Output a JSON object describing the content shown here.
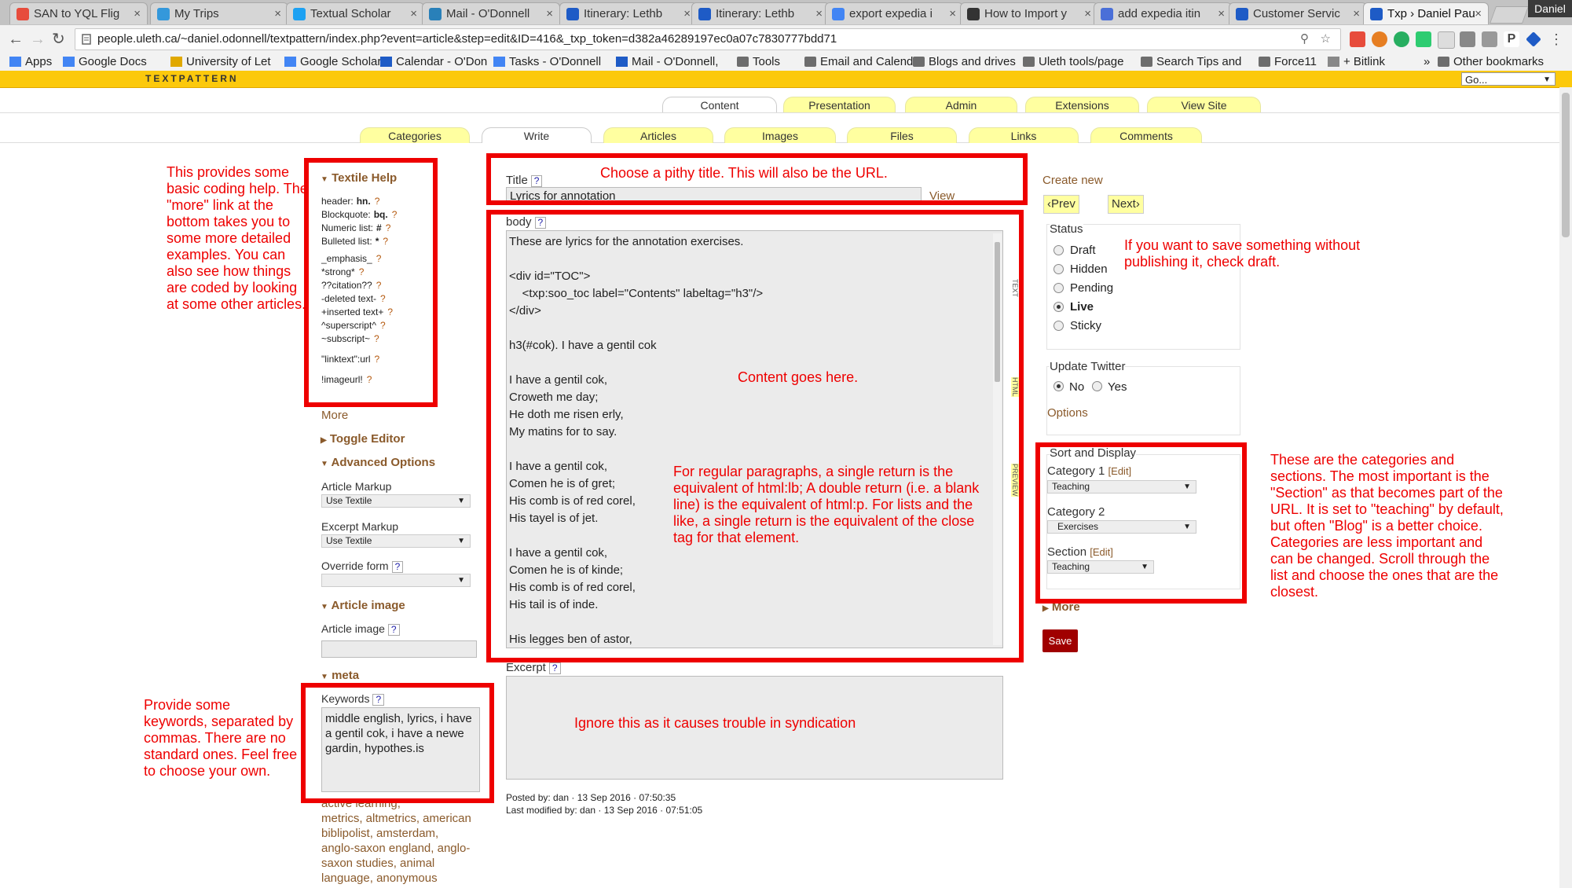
{
  "browser": {
    "tabs": [
      {
        "label": "SAN to YQL Flig"
      },
      {
        "label": "My Trips"
      },
      {
        "label": "Textual Scholar"
      },
      {
        "label": "Mail - O'Donnell"
      },
      {
        "label": "Itinerary: Lethb"
      },
      {
        "label": "Itinerary: Lethb"
      },
      {
        "label": "export expedia i"
      },
      {
        "label": "How to Import y"
      },
      {
        "label": "add expedia itin"
      },
      {
        "label": "Customer Servic"
      },
      {
        "label": "Txp › Daniel Pau"
      }
    ],
    "profile": "Daniel",
    "url": "people.uleth.ca/~daniel.odonnell/textpattern/index.php?event=article&step=edit&ID=416&_txp_token=d382a46289197ec0a07c7830777bdd71",
    "bookmarks": [
      {
        "label": "Apps"
      },
      {
        "label": "Google Docs"
      },
      {
        "label": "University of Let"
      },
      {
        "label": "Google Scholar"
      },
      {
        "label": "Calendar - O'Don"
      },
      {
        "label": "Tasks - O'Donnell"
      },
      {
        "label": "Mail - O'Donnell,"
      },
      {
        "label": "Tools"
      },
      {
        "label": "Email and Calend"
      },
      {
        "label": "Blogs and drives"
      },
      {
        "label": "Uleth tools/page"
      },
      {
        "label": "Search Tips and"
      },
      {
        "label": "Force11"
      },
      {
        "label": "+ Bitlink"
      }
    ],
    "more_chevron": "»",
    "other_bookmarks": "Other bookmarks"
  },
  "textpattern": {
    "logo": "TEXTPATTERN",
    "go_select": "Go...",
    "top_tabs": [
      {
        "label": "Content"
      },
      {
        "label": "Presentation"
      },
      {
        "label": "Admin"
      },
      {
        "label": "Extensions"
      },
      {
        "label": "View Site"
      }
    ],
    "sub_tabs": [
      {
        "label": "Categories"
      },
      {
        "label": "Write"
      },
      {
        "label": "Articles"
      },
      {
        "label": "Images"
      },
      {
        "label": "Files"
      },
      {
        "label": "Links"
      },
      {
        "label": "Comments"
      }
    ]
  },
  "left": {
    "textile_help_title": "Textile Help",
    "help_items": [
      {
        "label": "header:",
        "code": "hn.",
        "q": "?"
      },
      {
        "label": "Blockquote:",
        "code": "bq.",
        "q": "?"
      },
      {
        "label": "Numeric list:",
        "code": "#",
        "q": "?"
      },
      {
        "label": "Bulleted list:",
        "code": "*",
        "q": "?"
      },
      {
        "label": "_emphasis_",
        "code": "",
        "q": "?"
      },
      {
        "label": "*strong*",
        "code": "",
        "q": "?"
      },
      {
        "label": "??citation??",
        "code": "",
        "q": "?"
      },
      {
        "label": "-deleted text-",
        "code": "",
        "q": "?"
      },
      {
        "label": "+inserted text+",
        "code": "",
        "q": "?"
      },
      {
        "label": "^superscript^",
        "code": "",
        "q": "?"
      },
      {
        "label": "~subscript~",
        "code": "",
        "q": "?"
      },
      {
        "label": "\"linktext\":url",
        "code": "",
        "q": "?"
      },
      {
        "label": "!imageurl!",
        "code": "",
        "q": "?"
      }
    ],
    "more": "More",
    "toggle_editor": "Toggle Editor",
    "advanced_options": "Advanced Options",
    "article_markup_label": "Article Markup",
    "article_markup_value": "Use Textile",
    "excerpt_markup_label": "Excerpt Markup",
    "excerpt_markup_value": "Use Textile",
    "override_form_label": "Override form",
    "override_form_q": "?",
    "article_image_heading": "Article image",
    "article_image_label": "Article image",
    "article_image_q": "?",
    "meta_heading": "meta",
    "keywords_label": "Keywords",
    "keywords_q": "?",
    "keywords_value": "middle english, lyrics, i have a gentil cok, i have a newe gardin, hypothes.is",
    "keyword_links": [
      "active learning,",
      "metrics, altmetrics, american",
      "biblipolist, amsterdam,",
      "anglo-saxon england, anglo-",
      "saxon studies, animal",
      "language, anonymous"
    ]
  },
  "center": {
    "title_label": "Title",
    "title_q": "?",
    "title_value": "Lyrics for annotation",
    "view_link": "View",
    "body_label": "body",
    "body_q": "?",
    "body_lines": [
      "These are lyrics for the annotation exercises.",
      "",
      "<div id=\"TOC\">",
      "    <txp:soo_toc label=\"Contents\" labeltag=\"h3\"/>",
      "</div>",
      "",
      "h3(#cok). I have a gentil cok",
      "",
      "I have a gentil cok,",
      "Croweth me day;",
      "He doth me risen erly,",
      "My matins for to say.",
      "",
      "I have a gentil cok,",
      "Comen he is of gret;",
      "His comb is of red corel,",
      "His tayel is of jet.",
      "",
      "I have a gentil cok,",
      "Comen he is of kinde;",
      "His comb is of red corel,",
      "His tail is of inde.",
      "",
      "His legges ben of astor,"
    ],
    "vertical_tabs": [
      "Text",
      "HTML",
      "Preview"
    ],
    "excerpt_label": "Excerpt",
    "excerpt_q": "?",
    "posted_by": "Posted by: dan · 13 Sep 2016 · 07:50:35",
    "last_modified": "Last modified by: dan · 13 Sep 2016 · 07:51:05"
  },
  "right": {
    "create_new": "Create new",
    "prev": "‹Prev",
    "next": "Next›",
    "status_label": "Status",
    "status_options": [
      {
        "label": "Draft",
        "checked": false
      },
      {
        "label": "Hidden",
        "checked": false
      },
      {
        "label": "Pending",
        "checked": false
      },
      {
        "label": "Live",
        "checked": true
      },
      {
        "label": "Sticky",
        "checked": false
      }
    ],
    "update_twitter_label": "Update Twitter",
    "twitter_no": "No",
    "twitter_yes": "Yes",
    "options_link": "Options",
    "sort_display_label": "Sort and Display",
    "category1_label": "Category 1",
    "category1_edit": "[Edit]",
    "category1_value": "Teaching",
    "category2_label": "Category 2",
    "category2_value": "Exercises",
    "section_label": "Section",
    "section_edit": "[Edit]",
    "section_value": "Teaching",
    "more": "More",
    "save": "Save"
  },
  "annotations": {
    "textile_help": "This provides some basic coding help. The \"more\" link at the bottom takes you to some more detailed examples. You can also see how things are coded by looking at some other articles.",
    "title": "Choose a pithy title. This will also be the URL.",
    "content": "Content goes here.",
    "paragraphs": "For regular paragraphs, a single return is the equivalent of html:lb; A double return (i.e. a blank line) is the equivalent of html:p. For lists and the like, a single return is the equivalent of the close tag for that element.",
    "draft": "If you want to save something without publishing it, check draft.",
    "excerpt": "Ignore this as it causes trouble in syndication",
    "keywords": "Provide some keywords, separated by commas. There are no standard ones. Feel free to choose your own.",
    "categories": "These are the categories and sections. The most important is the \"Section\" as that becomes part of the URL. It is set to \"teaching\" by default, but often \"Blog\" is a better choice. Categories are less important and can be changed. Scroll through the list and choose the ones that are the closest."
  },
  "colors": {
    "annotation_red": "#e00000",
    "textpattern_yellow": "#fcc90c",
    "tab_yellow": "#ffffa0",
    "link_brown": "#8a5a2b",
    "save_red": "#a00000"
  }
}
